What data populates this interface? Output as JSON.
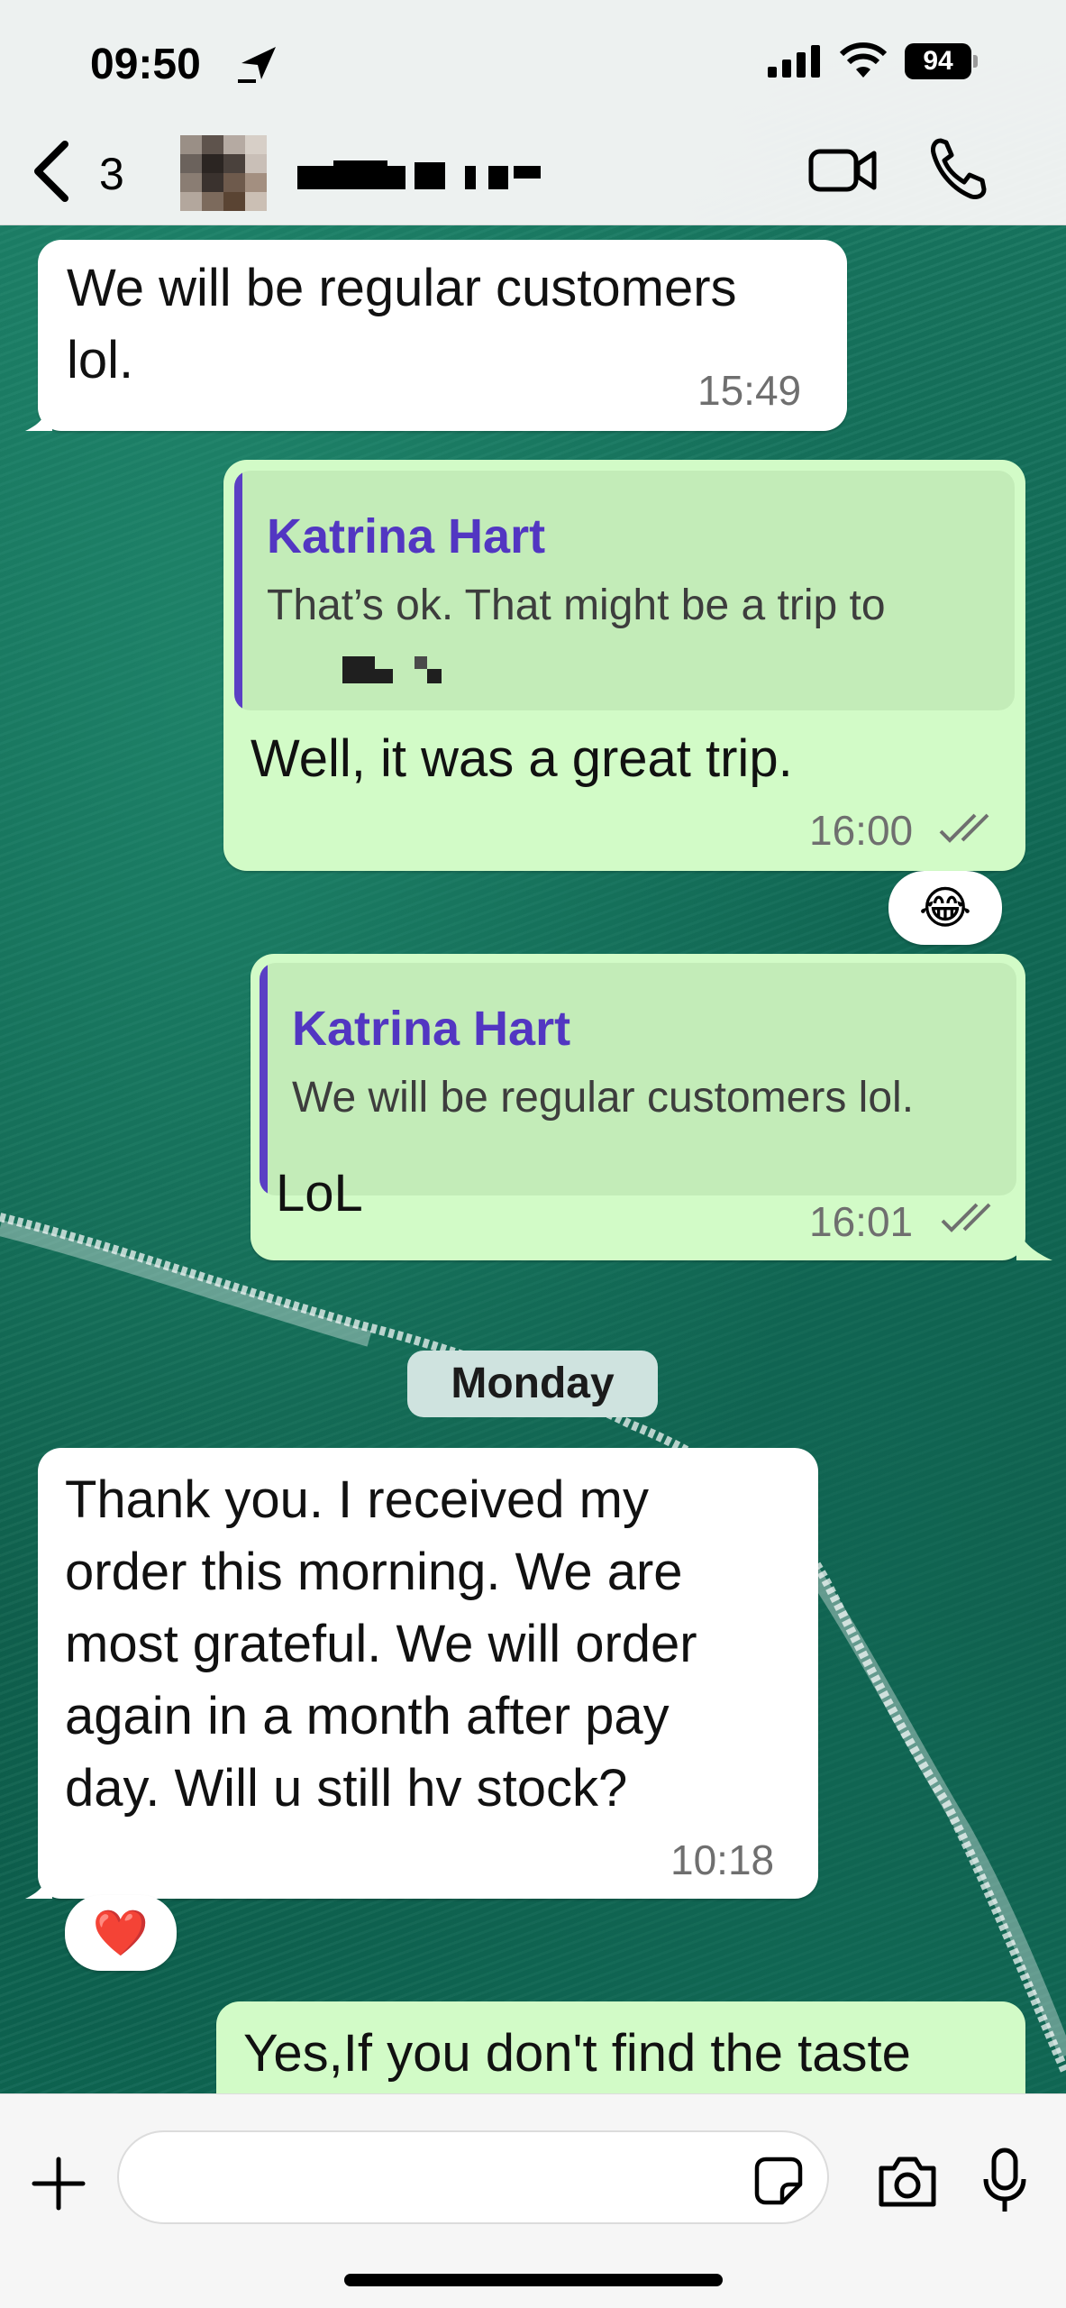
{
  "status_bar": {
    "time": "09:50",
    "battery": "94"
  },
  "header": {
    "back_count": "3",
    "icons": {
      "back": "chevron-left-icon",
      "video": "video-camera-icon",
      "call": "phone-icon"
    }
  },
  "messages": [
    {
      "direction": "incoming",
      "text_lines": [
        "We will be regular customers",
        "lol."
      ],
      "time": "15:49"
    },
    {
      "direction": "outgoing",
      "quote_author": "Katrina Hart",
      "quote_text": "That’s ok.  That might be a trip to",
      "text": "Well, it was a great trip.",
      "time": "16:00",
      "reaction": "😂"
    },
    {
      "direction": "outgoing",
      "quote_author": "Katrina Hart",
      "quote_text": "We will be regular customers lol.",
      "text": "LoL",
      "time": "16:01"
    },
    {
      "direction": "incoming",
      "text_lines": [
        "Thank you. I received my",
        "order this morning.  We are",
        "most grateful.  We will order",
        "again in a month after pay",
        "day.  Will u still hv stock?"
      ],
      "time": "10:18",
      "reaction": "❤️"
    },
    {
      "direction": "outgoing",
      "text": "Yes,If you don't find the taste"
    }
  ],
  "day_separator": "Monday",
  "composer": {
    "input_value": "",
    "icons": {
      "plus": "plus-icon",
      "sticker": "sticker-icon",
      "camera": "camera-icon",
      "mic": "microphone-icon"
    }
  },
  "colors": {
    "incoming_bubble": "#ffffff",
    "outgoing_bubble": "#d2fbc7",
    "quote_author": "#5236c2",
    "read_ticks": "#6f6f6f"
  }
}
